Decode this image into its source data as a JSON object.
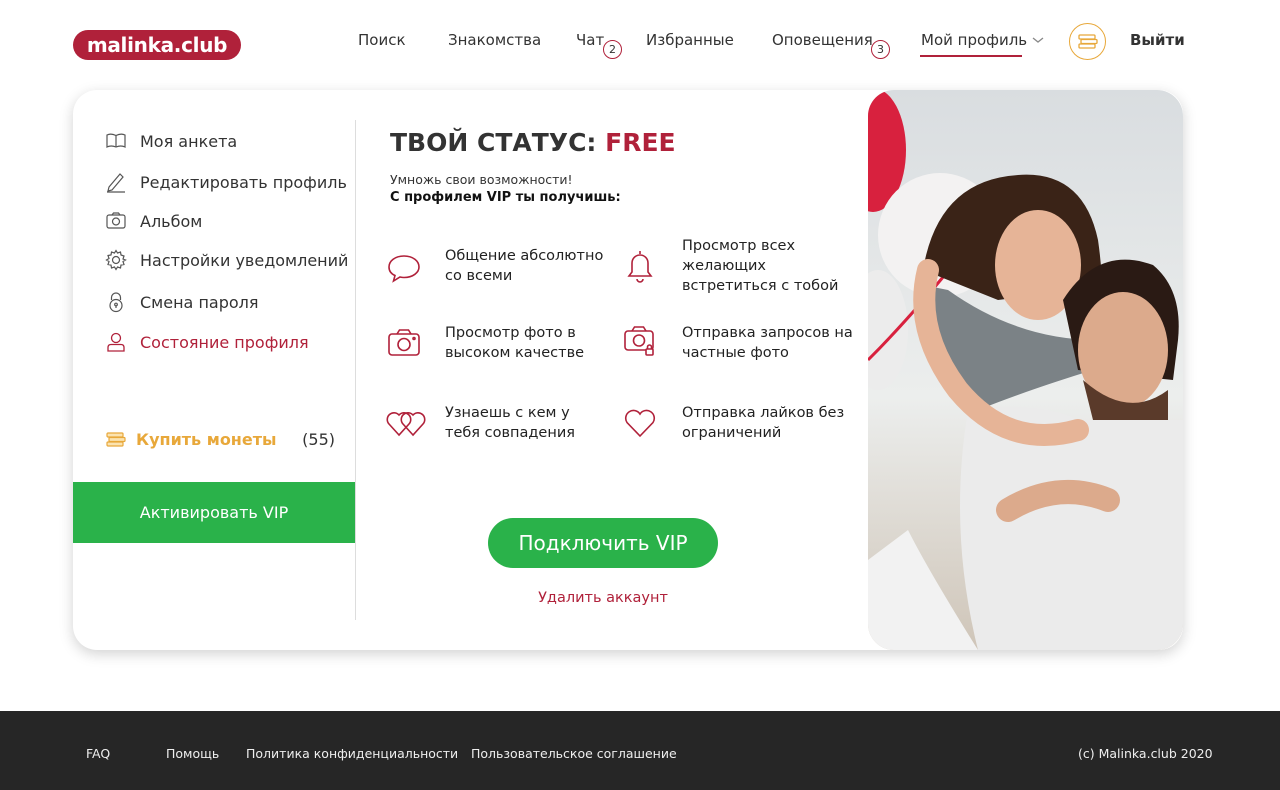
{
  "header": {
    "logo": "malinka.club",
    "nav": {
      "search": "Поиск",
      "dating": "Знакомства",
      "chat": "Чат",
      "chat_badge": "2",
      "favorites": "Избранные",
      "notifications": "Оповещения",
      "notifications_badge": "3",
      "profile": "Мой профиль"
    },
    "logout": "Выйти"
  },
  "sidebar": {
    "items": [
      {
        "label": "Моя анкета",
        "icon": "book-icon"
      },
      {
        "label": "Редактировать профиль",
        "icon": "pencil-icon"
      },
      {
        "label": "Альбом",
        "icon": "camera-icon"
      },
      {
        "label": "Настройки уведомлений",
        "icon": "gear-icon"
      },
      {
        "label": "Смена пароля",
        "icon": "lock-icon"
      },
      {
        "label": "Состояние профиля",
        "icon": "user-icon",
        "active": true
      }
    ],
    "buy_coins": "Купить монеты",
    "coins_count": "(55)",
    "activate_vip": "Активировать VIP"
  },
  "status": {
    "title_prefix": "ТВОЙ СТАТУС:",
    "title_value": "FREE",
    "subtitle": "Умножь свои возможности!",
    "subtitle_bold": "С профилем VIP ты получишь:"
  },
  "features": [
    {
      "text": "Общение абсолютно со всеми",
      "icon": "chat-bubble-icon"
    },
    {
      "text": "Просмотр всех желающих встретиться с тобой",
      "icon": "bell-icon"
    },
    {
      "text": "Просмотр фото в высоком качестве",
      "icon": "camera-icon"
    },
    {
      "text": "Отправка запросов на частные фото",
      "icon": "private-photo-icon"
    },
    {
      "text": "Узнаешь с кем у тебя совпадения",
      "icon": "two-hearts-icon"
    },
    {
      "text": "Отправка лайков без ограничений",
      "icon": "heart-icon"
    }
  ],
  "actions": {
    "connect_vip": "Подключить VIP",
    "delete_account": "Удалить аккаунт"
  },
  "footer": {
    "faq": "FAQ",
    "help": "Помощь",
    "privacy": "Политика конфиденциальности",
    "terms": "Пользовательское соглашение",
    "copyright": "(c) Malinka.club 2020"
  },
  "colors": {
    "brand": "#b0213a",
    "green": "#2ab24a",
    "gold": "#e8a83a",
    "footer_bg": "#262626"
  }
}
